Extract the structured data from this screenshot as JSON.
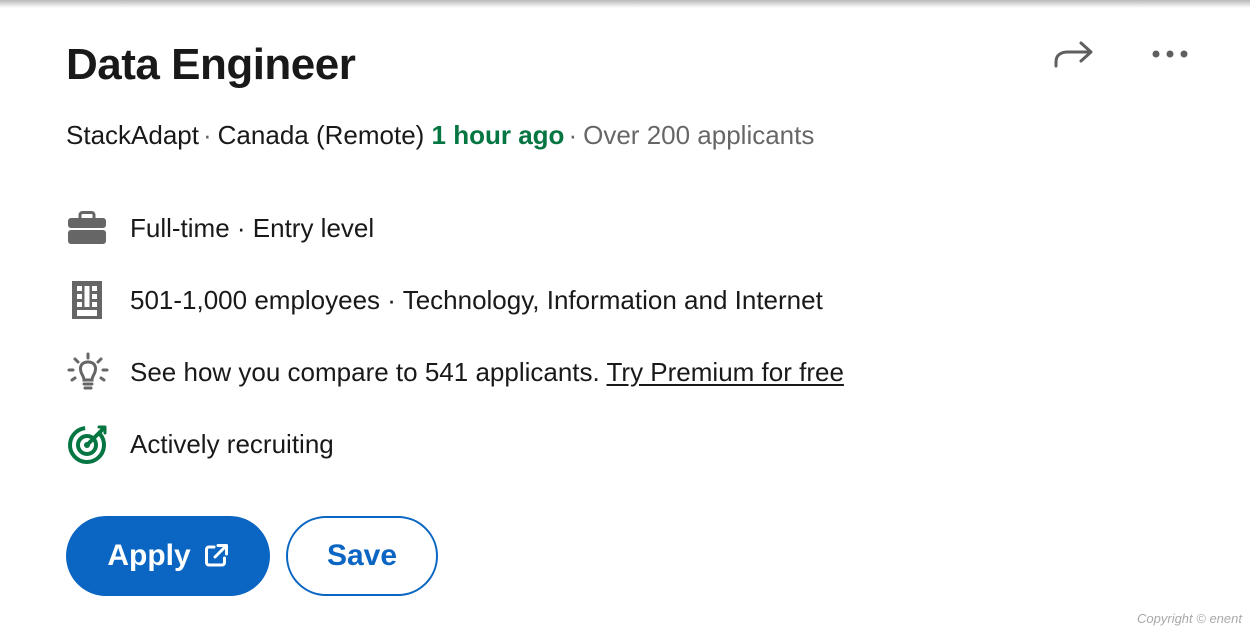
{
  "job": {
    "title": "Data Engineer",
    "company": "StackAdapt",
    "location": "Canada (Remote)",
    "posted": "1 hour ago",
    "applicants": "Over 200 applicants",
    "separator": "·"
  },
  "insights": [
    {
      "icon": "briefcase-icon",
      "text": "Full-time · Entry level"
    },
    {
      "icon": "building-icon",
      "text": "501-1,000 employees · Technology, Information and Internet"
    },
    {
      "icon": "lightbulb-icon",
      "text": "See how you compare to 541 applicants. ",
      "link": "Try Premium for free"
    },
    {
      "icon": "target-icon",
      "text": "Actively recruiting"
    }
  ],
  "actions": {
    "apply_label": "Apply",
    "save_label": "Save"
  },
  "footer": {
    "copyright": "Copyright © enent"
  },
  "colors": {
    "accent": "#0a66c2",
    "posted_green": "#057642",
    "icon_gray": "#666666"
  }
}
